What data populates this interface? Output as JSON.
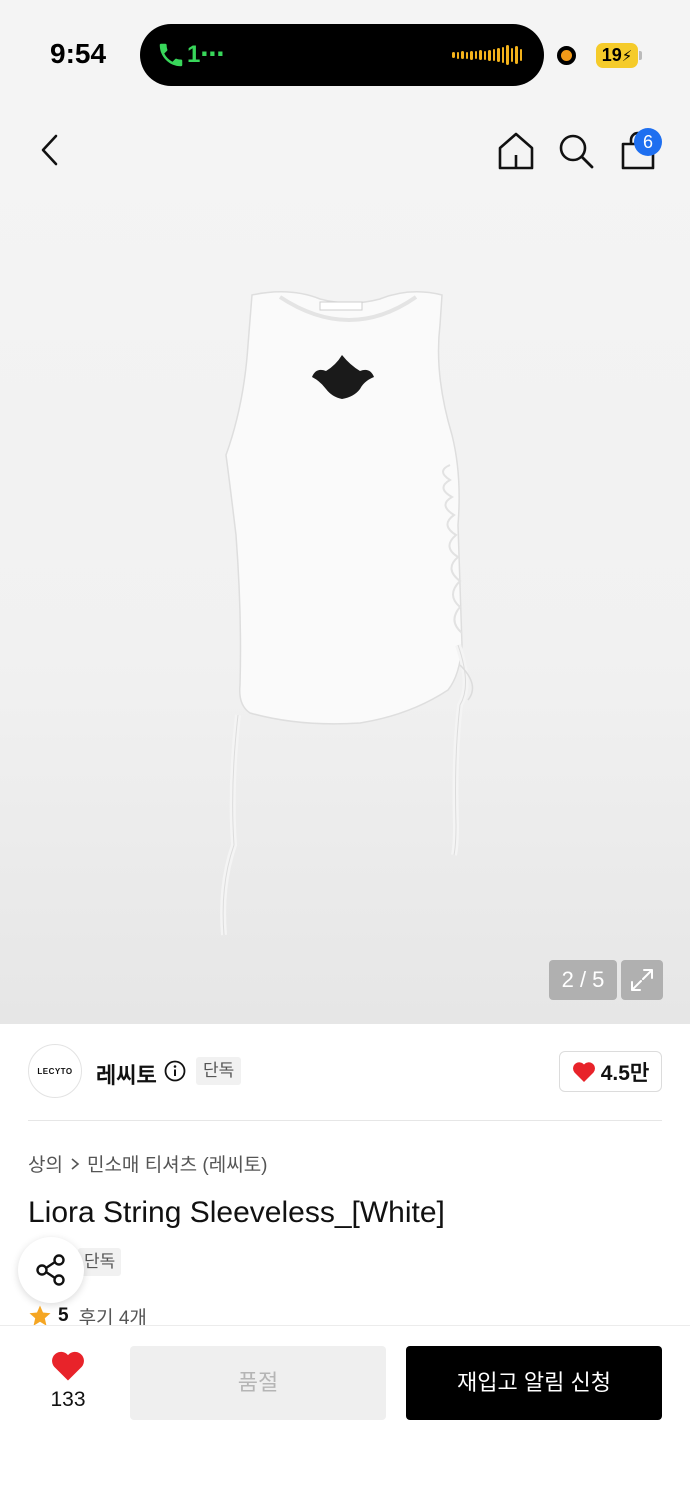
{
  "status_bar": {
    "time": "9:54",
    "call_indicator": "1⋯",
    "battery": "19"
  },
  "nav": {
    "cart_count": "6",
    "icons": [
      "back-icon",
      "home-icon",
      "search-icon",
      "cart-icon"
    ]
  },
  "gallery": {
    "counter": "2 / 5",
    "current": 2,
    "total": 5
  },
  "brand": {
    "logo_text": "LECYTO",
    "name": "레씨토",
    "tag": "단독",
    "likes": "4.5만"
  },
  "product": {
    "breadcrumb": [
      "상의",
      "민소매 티셔츠 (레씨토)"
    ],
    "title": "Liora String Sleeveless_[White]",
    "tag": "단독",
    "rating": "5",
    "review_label": "후기 4개"
  },
  "bottom_bar": {
    "wish_count": "133",
    "soldout_label": "품절",
    "restock_label": "재입고 알림 신청"
  },
  "colors": {
    "accent_blue": "#1e6ff0",
    "heart_red": "#e8232a",
    "star_orange": "#f5a623",
    "call_green": "#38d65a"
  }
}
